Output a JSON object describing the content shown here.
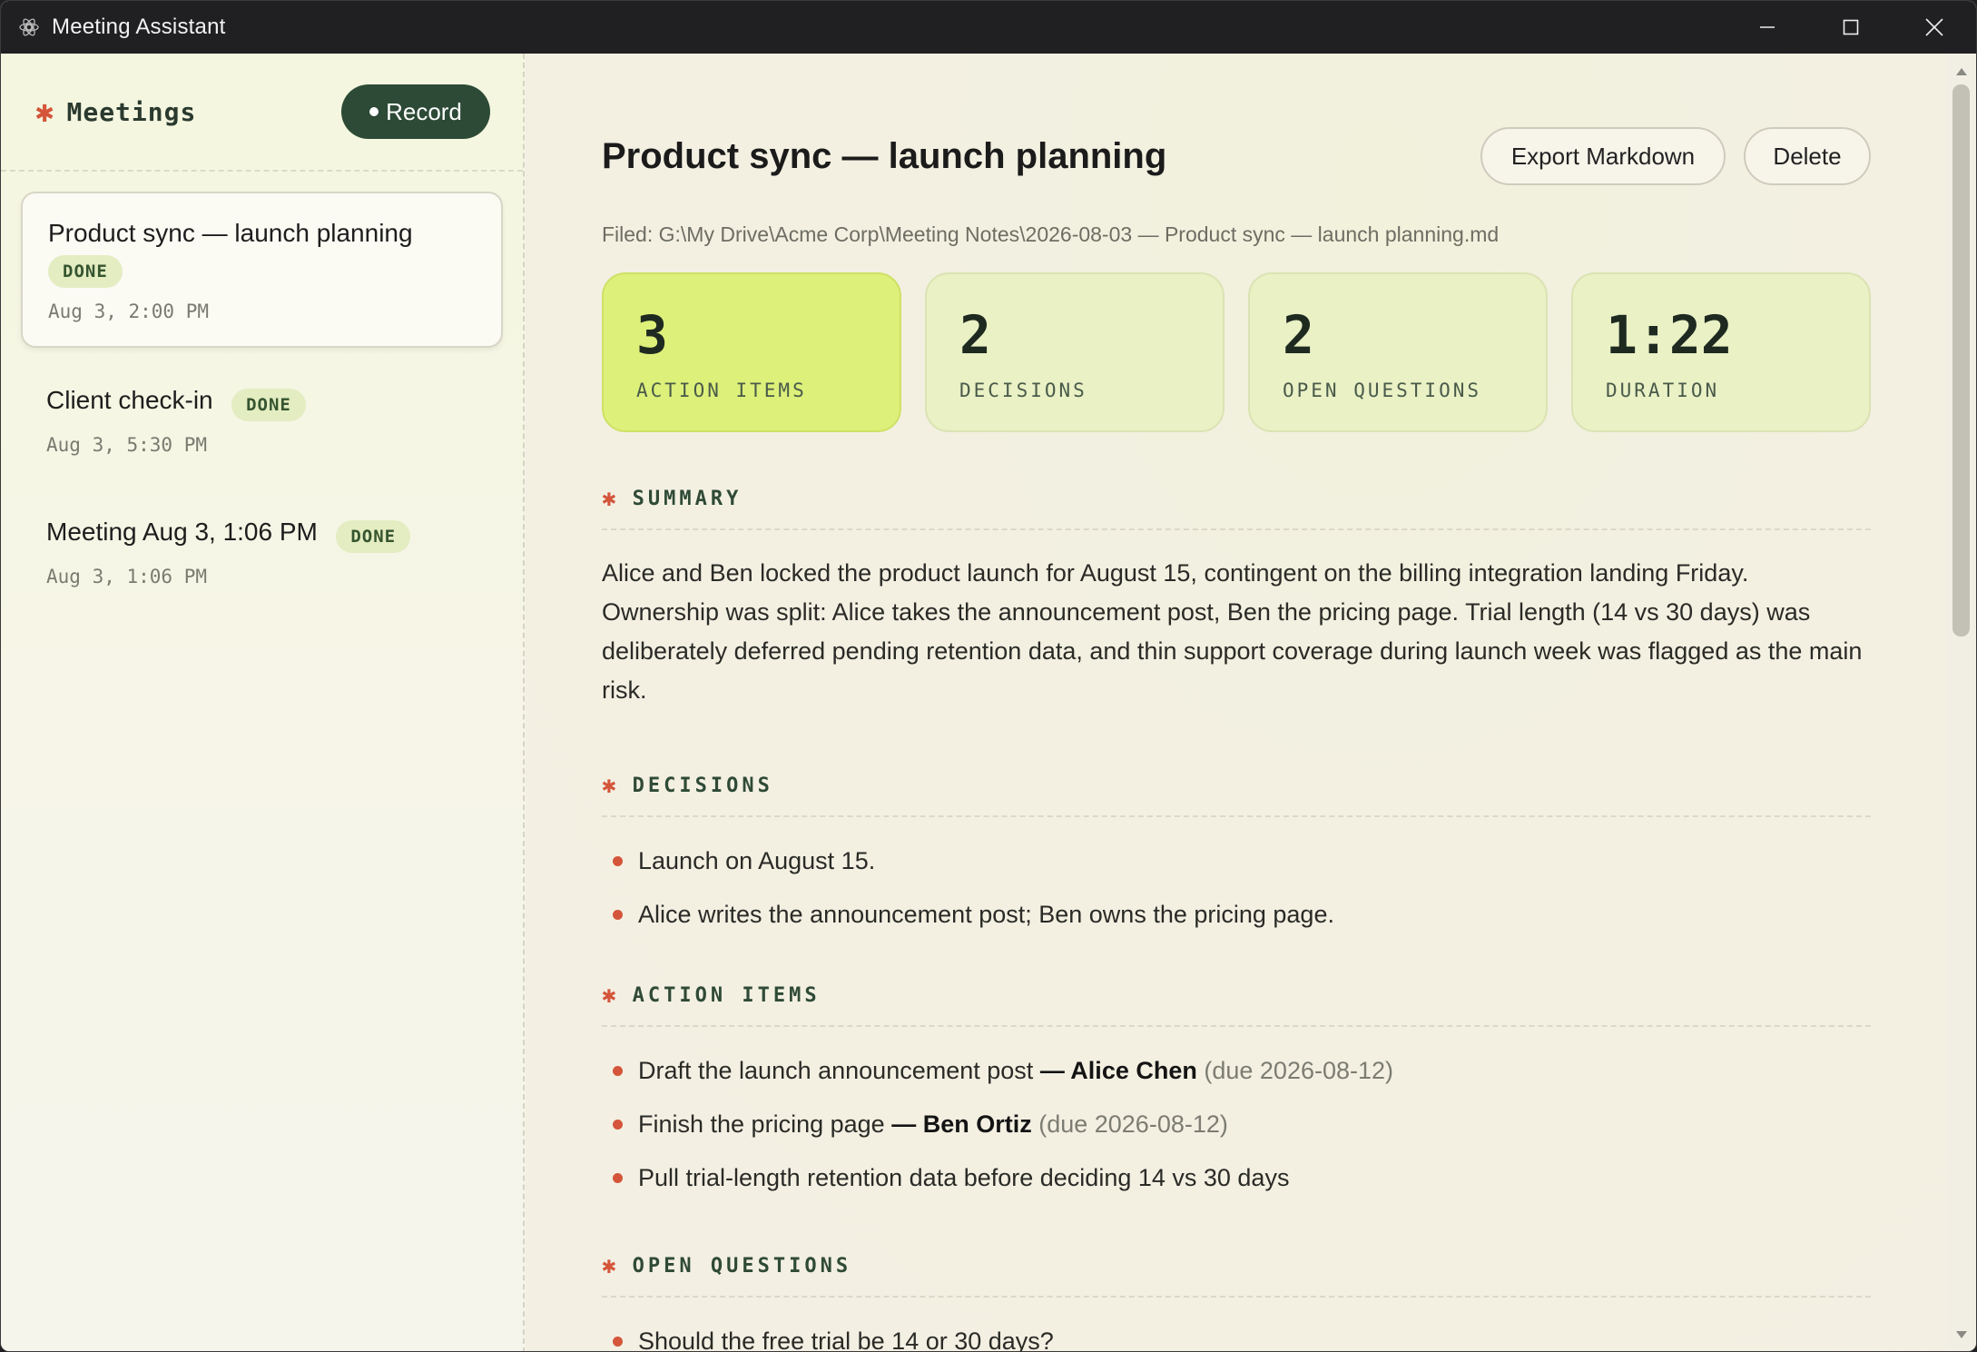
{
  "window": {
    "title": "Meeting Assistant",
    "icons": [
      "app-icon",
      "minimize-icon",
      "maximize-icon",
      "close-icon"
    ]
  },
  "sidebar": {
    "title": "Meetings",
    "record_label": "Record",
    "meetings": [
      {
        "name": "Product sync — launch planning",
        "status": "DONE",
        "time": "Aug 3, 2:00 PM",
        "active": true
      },
      {
        "name": "Client check-in",
        "status": "DONE",
        "time": "Aug 3, 5:30 PM",
        "active": false
      },
      {
        "name": "Meeting Aug 3, 1:06 PM",
        "status": "DONE",
        "time": "Aug 3, 1:06 PM",
        "active": false
      }
    ]
  },
  "main": {
    "title": "Product sync — launch planning",
    "export_label": "Export Markdown",
    "delete_label": "Delete",
    "filepath": "Filed: G:\\My Drive\\Acme Corp\\Meeting Notes\\2026-08-03 — Product sync — launch planning.md",
    "stats": [
      {
        "value": "3",
        "label": "ACTION ITEMS"
      },
      {
        "value": "2",
        "label": "DECISIONS"
      },
      {
        "value": "2",
        "label": "OPEN QUESTIONS"
      },
      {
        "value": "1:22",
        "label": "DURATION"
      }
    ],
    "summary": {
      "heading": "SUMMARY",
      "text": "Alice and Ben locked the product launch for August 15, contingent on the billing integration landing Friday. Ownership was split: Alice takes the announcement post, Ben the pricing page. Trial length (14 vs 30 days) was deliberately deferred pending retention data, and thin support coverage during launch week was flagged as the main risk."
    },
    "decisions": {
      "heading": "DECISIONS",
      "items": [
        "Launch on August 15.",
        "Alice writes the announcement post; Ben owns the pricing page."
      ]
    },
    "action_items": {
      "heading": "ACTION ITEMS",
      "items": [
        {
          "task": "Draft the launch announcement post",
          "owner": "— Alice Chen",
          "due": "(due 2026-08-12)"
        },
        {
          "task": "Finish the pricing page",
          "owner": "— Ben Ortiz",
          "due": "(due 2026-08-12)"
        },
        {
          "task": "Pull trial-length retention data before deciding 14 vs 30 days",
          "owner": "",
          "due": ""
        }
      ]
    },
    "open_questions": {
      "heading": "OPEN QUESTIONS",
      "items": [
        "Should the free trial be 14 or 30 days?"
      ]
    }
  },
  "colors": {
    "accent_asterisk": "#d4553a",
    "record_button": "#2c4a36",
    "highlight_card": "#ddf07a",
    "card": "#e9f1c5"
  }
}
